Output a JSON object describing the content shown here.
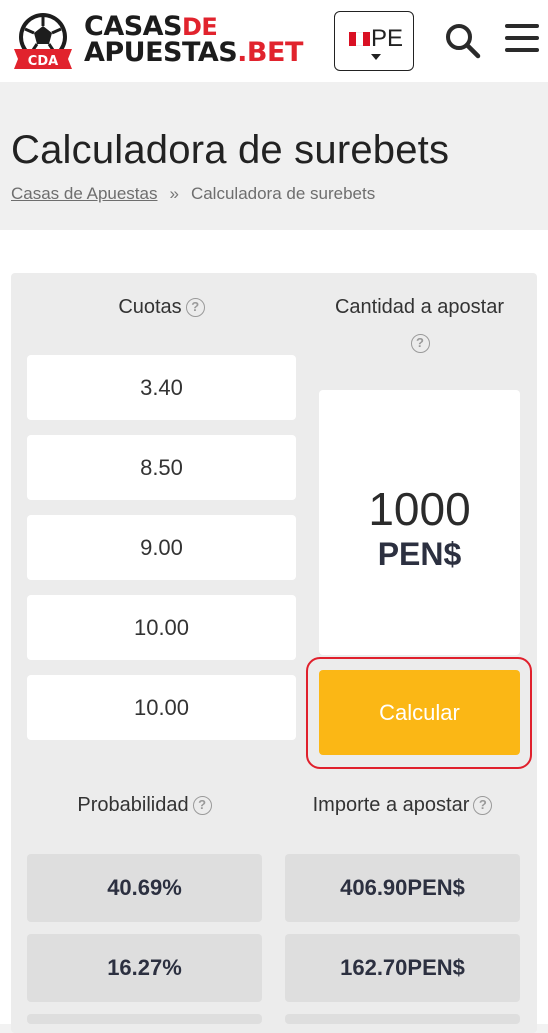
{
  "header": {
    "logo_badge": "CDA",
    "logo_line1_a": "CASAS",
    "logo_line1_b": "DE",
    "logo_line2_a": "APUESTAS",
    "logo_line2_b": ".BET",
    "country_code": "PE",
    "search_icon": "search-icon",
    "menu_icon": "hamburger-menu-icon"
  },
  "page": {
    "title": "Calculadora de surebets",
    "breadcrumb": {
      "home": "Casas de Apuestas",
      "separator": "»",
      "current": "Calculadora de surebets"
    }
  },
  "calculator": {
    "odds_header": "Cuotas",
    "stake_header": "Cantidad a apostar",
    "odds": [
      "3.40",
      "8.50",
      "9.00",
      "10.00",
      "10.00"
    ],
    "stake_amount": "1000",
    "stake_currency": "PEN$",
    "calc_button": "Calcular",
    "probability_header": "Probabilidad",
    "amount_header": "Importe a apostar",
    "probabilities": [
      "40.69%",
      "16.27%"
    ],
    "amounts": [
      "406.90PEN$",
      "162.70PEN$"
    ],
    "help_glyph": "?"
  },
  "colors": {
    "accent_red": "#e1232d",
    "button_yellow": "#fbb715",
    "highlight_outline": "#e0202c"
  }
}
